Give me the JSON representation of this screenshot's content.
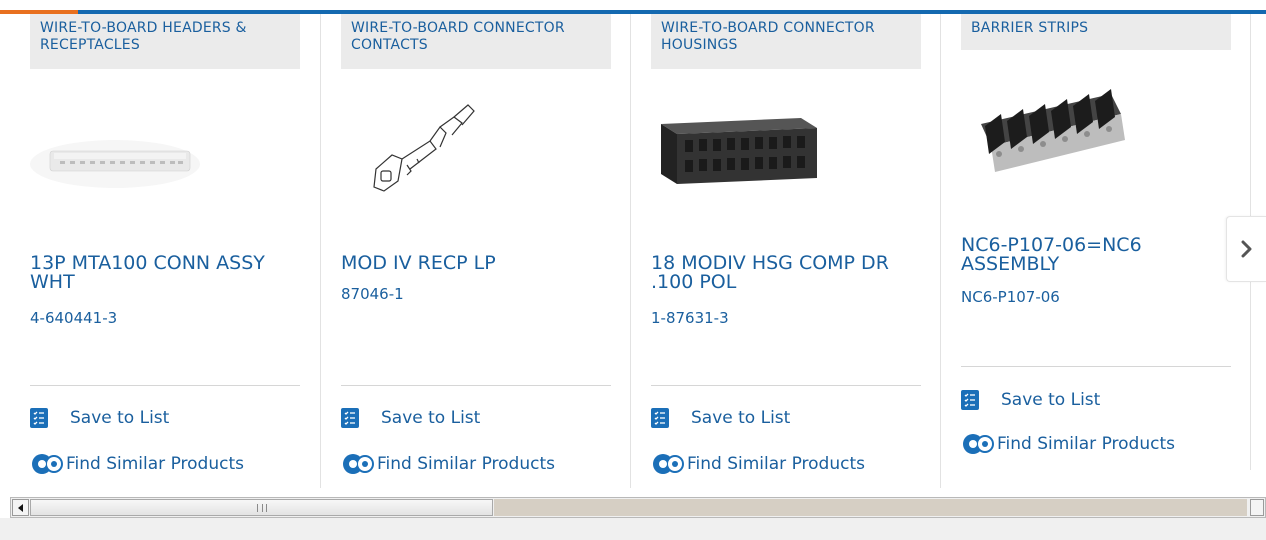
{
  "products": [
    {
      "category": "WIRE-TO-BOARD HEADERS & RECEPTACLES",
      "title": "13P MTA100 CONN ASSY WHT",
      "part_number": "4-640441-3",
      "image": "white-header-connector",
      "save_label": "Save to List",
      "similar_label": "Find Similar Products"
    },
    {
      "category": "WIRE-TO-BOARD CONNECTOR CONTACTS",
      "title": "MOD IV RECP LP",
      "part_number": "87046-1",
      "image": "crimp-contact-drawing",
      "save_label": "Save to List",
      "similar_label": "Find Similar Products"
    },
    {
      "category": "WIRE-TO-BOARD CONNECTOR HOUSINGS",
      "title": "18 MODIV HSG COMP DR .100 POL",
      "part_number": "1-87631-3",
      "image": "black-connector-housing",
      "save_label": "Save to List",
      "similar_label": "Find Similar Products"
    },
    {
      "category": "BARRIER STRIPS",
      "title": "NC6-P107-06=NC6 ASSEMBLY",
      "part_number": "NC6-P107-06",
      "image": "barrier-strip-block",
      "save_label": "Save to List",
      "similar_label": "Find Similar Products"
    }
  ],
  "icons": {
    "save": "checklist-icon",
    "similar": "gears-icon",
    "next": "chevron-right-icon"
  },
  "colors": {
    "accent": "#e8701f",
    "brand_blue": "#1469b0",
    "link": "#1a5f9e",
    "category_bg": "#ebebeb"
  }
}
